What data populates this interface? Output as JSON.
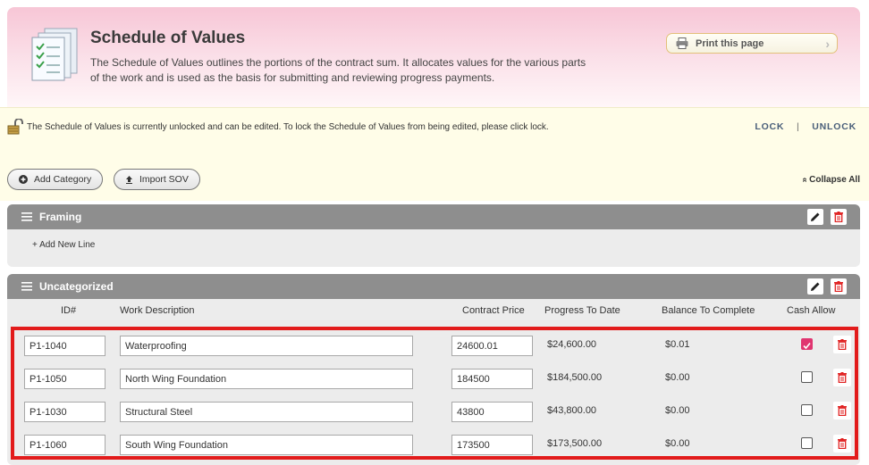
{
  "header": {
    "title": "Schedule of Values",
    "description": "The Schedule of Values outlines the portions of the contract sum. It allocates values for the various parts of the work and is used as the basis for submitting and reviewing progress payments.",
    "print_label": "Print this page",
    "print_chevron": "›"
  },
  "lock_bar": {
    "message": "The Schedule of Values is currently unlocked and can be edited. To lock the Schedule of Values from being edited, please click lock.",
    "lock_label": "LOCK",
    "separator": "|",
    "unlock_label": "UNLOCK"
  },
  "toolbar": {
    "add_category_label": "Add Category",
    "import_sov_label": "Import SOV",
    "collapse_all_label": "Collapse All",
    "collapse_glyph": "«"
  },
  "categories": [
    {
      "name": "Framing",
      "add_line_label": "+ Add New Line"
    },
    {
      "name": "Uncategorized"
    }
  ],
  "columns": {
    "id": "ID#",
    "description": "Work Description",
    "contract_price": "Contract Price",
    "progress": "Progress To Date",
    "balance": "Balance To Complete",
    "cash_allow": "Cash Allow"
  },
  "rows": [
    {
      "id": "P1-1040",
      "description": "Waterproofing",
      "contract_price": "24600.01",
      "progress": "$24,600.00",
      "balance": "$0.01",
      "cash_allow": true
    },
    {
      "id": "P1-1050",
      "description": "North Wing Foundation",
      "contract_price": "184500",
      "progress": "$184,500.00",
      "balance": "$0.00",
      "cash_allow": false
    },
    {
      "id": "P1-1030",
      "description": "Structural Steel",
      "contract_price": "43800",
      "progress": "$43,800.00",
      "balance": "$0.00",
      "cash_allow": false
    },
    {
      "id": "P1-1060",
      "description": "South Wing Foundation",
      "contract_price": "173500",
      "progress": "$173,500.00",
      "balance": "$0.00",
      "cash_allow": false
    }
  ],
  "colors": {
    "header_pink": "#f7c6d6",
    "category_gray": "#8e8e8e",
    "highlight_red": "#e21b1b",
    "checkbox_pink": "#e03570",
    "trash_red": "#e02020"
  },
  "icons": [
    "document-checklist-icon",
    "printer-icon",
    "padlock-icon",
    "plus-circle-icon",
    "upload-icon",
    "collapse-icon",
    "hamburger-icon",
    "pencil-icon",
    "trash-icon"
  ]
}
